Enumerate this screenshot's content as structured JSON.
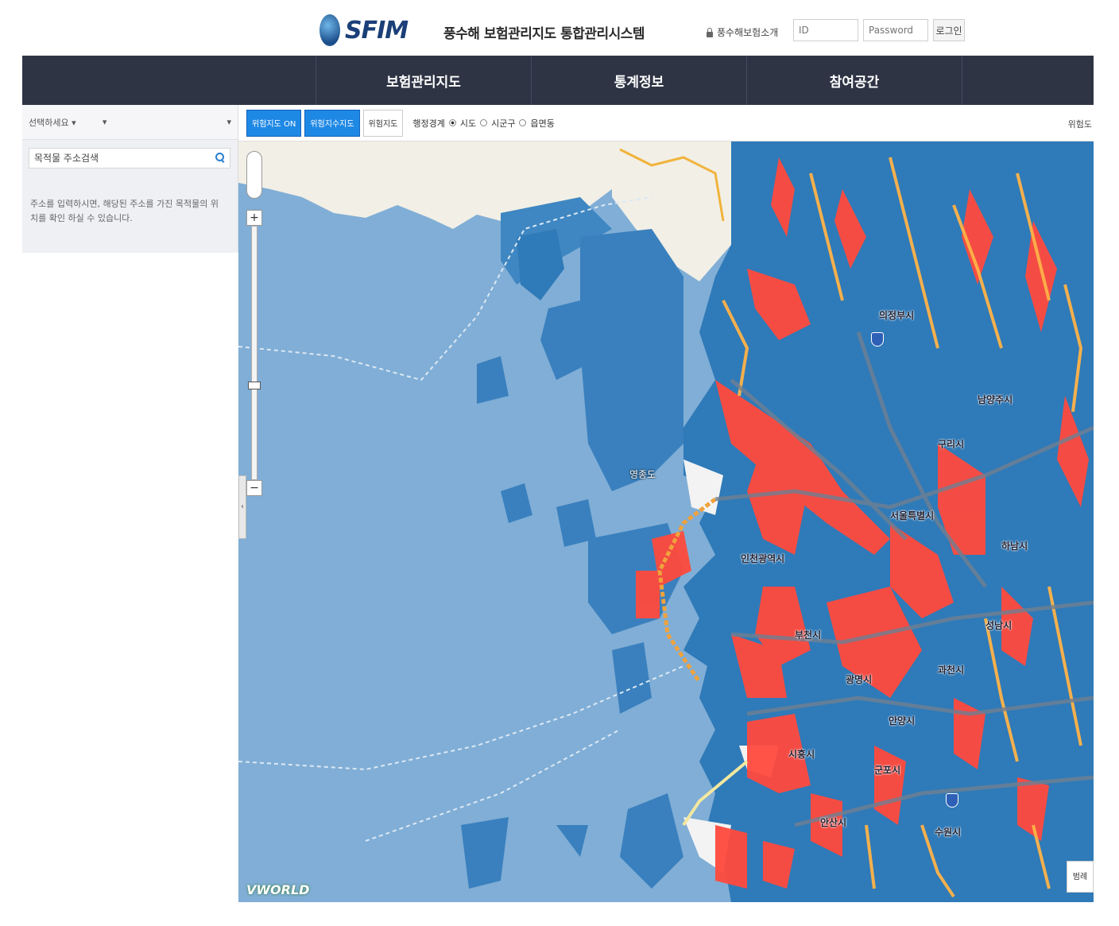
{
  "header": {
    "logo_text": "SFIM",
    "logo_subtitle": "",
    "system_title": "풍수해 보험관리지도 통합관리시스템",
    "intro_link": "풍수해보험소개",
    "login": {
      "id_placeholder": "ID",
      "password_placeholder": "Password",
      "login_button": "로그인"
    }
  },
  "nav": {
    "items": [
      {
        "label": "보험관리지도"
      },
      {
        "label": "통계정보"
      },
      {
        "label": "참여공간"
      }
    ]
  },
  "side_panel": {
    "select_1": "선택하세요 ▾",
    "select_2": "▾",
    "select_3": "▾",
    "search": {
      "placeholder": "목적물 주소검색"
    },
    "help_text": "주소를 입력하시면, 해당된 주소를 가진 목적물의 위치를 확인 하실 수 있습니다."
  },
  "toolbar": {
    "buttons": [
      {
        "label": "위험지도 ON"
      },
      {
        "label": "위험지수지도"
      },
      {
        "label": "위험지도"
      }
    ],
    "layers_label": "행정경계",
    "layers": [
      {
        "label": "시도",
        "selected": true
      },
      {
        "label": "시군구",
        "selected": false
      },
      {
        "label": "읍면동",
        "selected": false
      }
    ],
    "right_label": "위험도"
  },
  "map": {
    "labels": [
      "의정부시",
      "남양주시",
      "구리시",
      "서울특별시",
      "인천광역시",
      "부천시",
      "광명시",
      "안양시",
      "과천시",
      "하남시",
      "성남시",
      "시흥시",
      "안산시",
      "군포시",
      "수원시",
      "영종도"
    ],
    "zoom_in": "+",
    "zoom_out": "−",
    "collapse": "‹",
    "logo": "VWORLD",
    "legend_button": "범례"
  },
  "colors": {
    "nav_bg": "#2e3444",
    "sea": "#80aed6",
    "land": "#2f7ab8",
    "risk_high": "#ff4a3d",
    "risk_mid": "#ffb347",
    "primary_button": "#1e88e5"
  }
}
